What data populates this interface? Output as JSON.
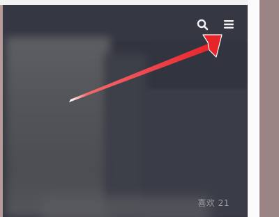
{
  "header": {
    "search_icon": "search-icon",
    "menu_icon": "menu-icon"
  },
  "feed": {
    "likes_text": "喜欢 21"
  },
  "annotation": {
    "arrow_color": "#e8242b"
  }
}
